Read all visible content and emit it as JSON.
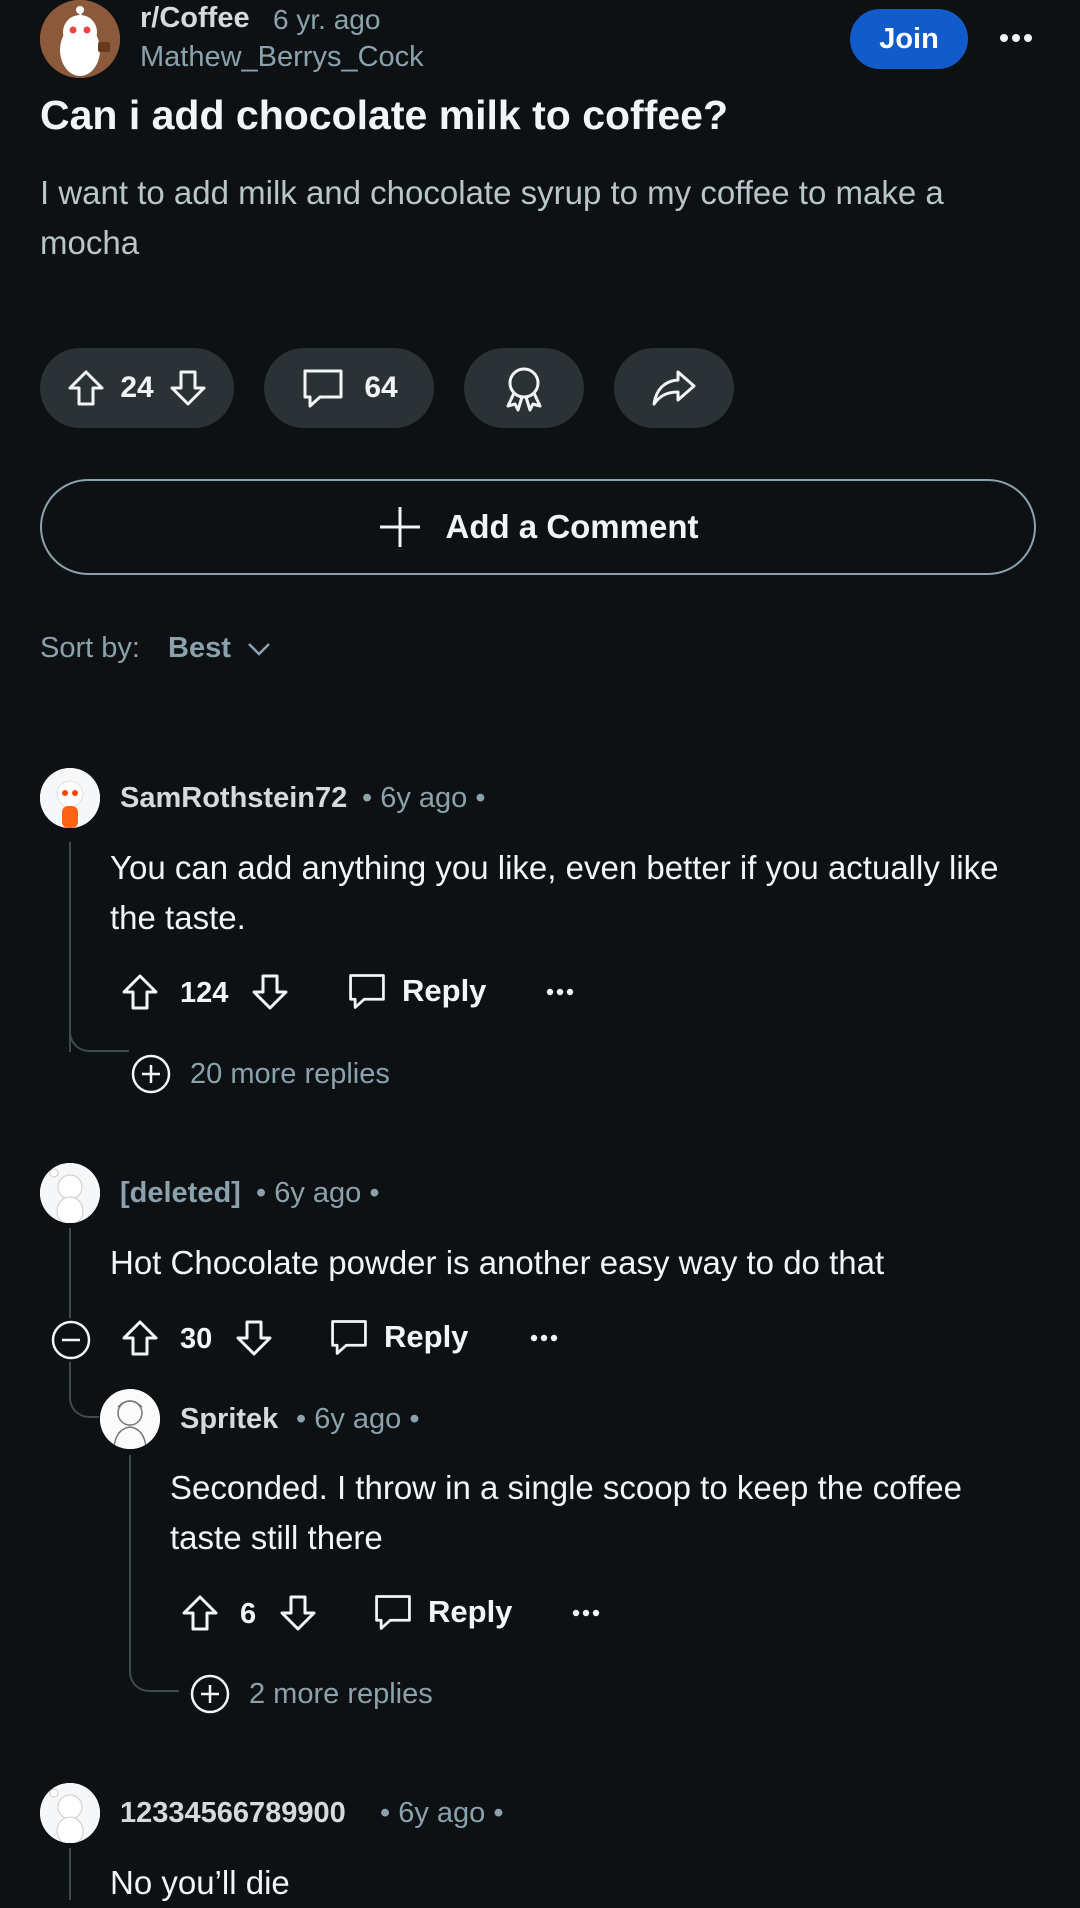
{
  "post": {
    "subreddit": "r/Coffee",
    "age": "6 yr. ago",
    "author": "Mathew_Berrys_Cock",
    "join_label": "Join",
    "title": "Can i add chocolate milk to coffee?",
    "body": "I want to add milk and chocolate syrup to my coffee to make a mocha",
    "score": "24",
    "comment_count": "64"
  },
  "add_comment_label": "Add a Comment",
  "sort": {
    "label": "Sort by:",
    "value": "Best"
  },
  "comments": [
    {
      "user": "SamRothstein72",
      "meta": "• 6y ago •",
      "text": "You can add anything you like, even better if you actually like the taste.",
      "score": "124",
      "reply_label": "Reply",
      "more_replies": "20 more replies"
    },
    {
      "user": "[deleted]",
      "meta": "• 6y ago •",
      "text": "Hot Chocolate powder is another easy way to do that",
      "score": "30",
      "reply_label": "Reply"
    },
    {
      "user": "Spritek",
      "meta": "• 6y ago •",
      "text": "Seconded. I throw in a single scoop to keep the coffee taste still there",
      "score": "6",
      "reply_label": "Reply",
      "more_replies": "2 more replies"
    },
    {
      "user": "12334566789900",
      "meta": "• 6y ago •",
      "text": "No you’ll die"
    }
  ],
  "colors": {
    "background": "#0e1113",
    "pill": "#2a3236",
    "join": "#115bca",
    "muted": "#8ba2ad"
  }
}
